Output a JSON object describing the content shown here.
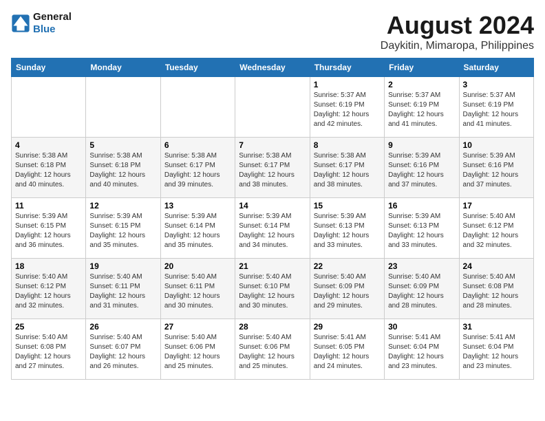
{
  "header": {
    "logo_line1": "General",
    "logo_line2": "Blue",
    "main_title": "August 2024",
    "subtitle": "Daykitin, Mimaropa, Philippines"
  },
  "days_of_week": [
    "Sunday",
    "Monday",
    "Tuesday",
    "Wednesday",
    "Thursday",
    "Friday",
    "Saturday"
  ],
  "weeks": [
    [
      {
        "day": "",
        "content": ""
      },
      {
        "day": "",
        "content": ""
      },
      {
        "day": "",
        "content": ""
      },
      {
        "day": "",
        "content": ""
      },
      {
        "day": "1",
        "content": "Sunrise: 5:37 AM\nSunset: 6:19 PM\nDaylight: 12 hours\nand 42 minutes."
      },
      {
        "day": "2",
        "content": "Sunrise: 5:37 AM\nSunset: 6:19 PM\nDaylight: 12 hours\nand 41 minutes."
      },
      {
        "day": "3",
        "content": "Sunrise: 5:37 AM\nSunset: 6:19 PM\nDaylight: 12 hours\nand 41 minutes."
      }
    ],
    [
      {
        "day": "4",
        "content": "Sunrise: 5:38 AM\nSunset: 6:18 PM\nDaylight: 12 hours\nand 40 minutes."
      },
      {
        "day": "5",
        "content": "Sunrise: 5:38 AM\nSunset: 6:18 PM\nDaylight: 12 hours\nand 40 minutes."
      },
      {
        "day": "6",
        "content": "Sunrise: 5:38 AM\nSunset: 6:17 PM\nDaylight: 12 hours\nand 39 minutes."
      },
      {
        "day": "7",
        "content": "Sunrise: 5:38 AM\nSunset: 6:17 PM\nDaylight: 12 hours\nand 38 minutes."
      },
      {
        "day": "8",
        "content": "Sunrise: 5:38 AM\nSunset: 6:17 PM\nDaylight: 12 hours\nand 38 minutes."
      },
      {
        "day": "9",
        "content": "Sunrise: 5:39 AM\nSunset: 6:16 PM\nDaylight: 12 hours\nand 37 minutes."
      },
      {
        "day": "10",
        "content": "Sunrise: 5:39 AM\nSunset: 6:16 PM\nDaylight: 12 hours\nand 37 minutes."
      }
    ],
    [
      {
        "day": "11",
        "content": "Sunrise: 5:39 AM\nSunset: 6:15 PM\nDaylight: 12 hours\nand 36 minutes."
      },
      {
        "day": "12",
        "content": "Sunrise: 5:39 AM\nSunset: 6:15 PM\nDaylight: 12 hours\nand 35 minutes."
      },
      {
        "day": "13",
        "content": "Sunrise: 5:39 AM\nSunset: 6:14 PM\nDaylight: 12 hours\nand 35 minutes."
      },
      {
        "day": "14",
        "content": "Sunrise: 5:39 AM\nSunset: 6:14 PM\nDaylight: 12 hours\nand 34 minutes."
      },
      {
        "day": "15",
        "content": "Sunrise: 5:39 AM\nSunset: 6:13 PM\nDaylight: 12 hours\nand 33 minutes."
      },
      {
        "day": "16",
        "content": "Sunrise: 5:39 AM\nSunset: 6:13 PM\nDaylight: 12 hours\nand 33 minutes."
      },
      {
        "day": "17",
        "content": "Sunrise: 5:40 AM\nSunset: 6:12 PM\nDaylight: 12 hours\nand 32 minutes."
      }
    ],
    [
      {
        "day": "18",
        "content": "Sunrise: 5:40 AM\nSunset: 6:12 PM\nDaylight: 12 hours\nand 32 minutes."
      },
      {
        "day": "19",
        "content": "Sunrise: 5:40 AM\nSunset: 6:11 PM\nDaylight: 12 hours\nand 31 minutes."
      },
      {
        "day": "20",
        "content": "Sunrise: 5:40 AM\nSunset: 6:11 PM\nDaylight: 12 hours\nand 30 minutes."
      },
      {
        "day": "21",
        "content": "Sunrise: 5:40 AM\nSunset: 6:10 PM\nDaylight: 12 hours\nand 30 minutes."
      },
      {
        "day": "22",
        "content": "Sunrise: 5:40 AM\nSunset: 6:09 PM\nDaylight: 12 hours\nand 29 minutes."
      },
      {
        "day": "23",
        "content": "Sunrise: 5:40 AM\nSunset: 6:09 PM\nDaylight: 12 hours\nand 28 minutes."
      },
      {
        "day": "24",
        "content": "Sunrise: 5:40 AM\nSunset: 6:08 PM\nDaylight: 12 hours\nand 28 minutes."
      }
    ],
    [
      {
        "day": "25",
        "content": "Sunrise: 5:40 AM\nSunset: 6:08 PM\nDaylight: 12 hours\nand 27 minutes."
      },
      {
        "day": "26",
        "content": "Sunrise: 5:40 AM\nSunset: 6:07 PM\nDaylight: 12 hours\nand 26 minutes."
      },
      {
        "day": "27",
        "content": "Sunrise: 5:40 AM\nSunset: 6:06 PM\nDaylight: 12 hours\nand 25 minutes."
      },
      {
        "day": "28",
        "content": "Sunrise: 5:40 AM\nSunset: 6:06 PM\nDaylight: 12 hours\nand 25 minutes."
      },
      {
        "day": "29",
        "content": "Sunrise: 5:41 AM\nSunset: 6:05 PM\nDaylight: 12 hours\nand 24 minutes."
      },
      {
        "day": "30",
        "content": "Sunrise: 5:41 AM\nSunset: 6:04 PM\nDaylight: 12 hours\nand 23 minutes."
      },
      {
        "day": "31",
        "content": "Sunrise: 5:41 AM\nSunset: 6:04 PM\nDaylight: 12 hours\nand 23 minutes."
      }
    ]
  ]
}
